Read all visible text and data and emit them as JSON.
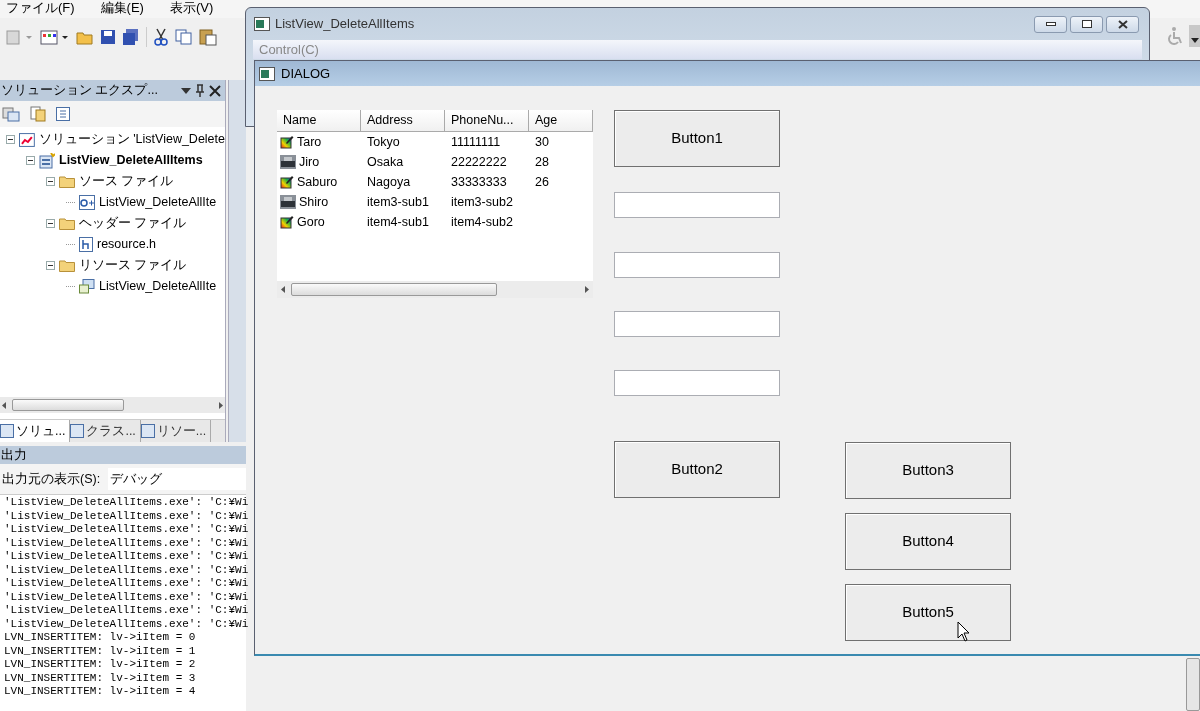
{
  "ide": {
    "menu": [
      "ファイル(F)",
      "編集(E)",
      "表示(V)"
    ],
    "solution_explorer": {
      "title": "ソリューション エクスプ...",
      "tree": [
        {
          "kind": "solution",
          "label": "ソリューション 'ListView_Delete",
          "expanded": true,
          "children": [
            {
              "kind": "project",
              "label": "ListView_DeleteAllItems",
              "expanded": true,
              "children": [
                {
                  "kind": "folder",
                  "label": "ソース ファイル",
                  "expanded": true,
                  "children": [
                    {
                      "kind": "cpp",
                      "label": "ListView_DeleteAllIte"
                    }
                  ]
                },
                {
                  "kind": "folder",
                  "label": "ヘッダー ファイル",
                  "expanded": true,
                  "children": [
                    {
                      "kind": "header",
                      "label": "resource.h"
                    }
                  ]
                },
                {
                  "kind": "folder",
                  "label": "リソース ファイル",
                  "expanded": true,
                  "children": [
                    {
                      "kind": "resource",
                      "label": "ListView_DeleteAllIte"
                    }
                  ]
                }
              ]
            }
          ]
        }
      ],
      "tabs": [
        {
          "label": "ソリュ...",
          "selected": true
        },
        {
          "label": "クラス...",
          "selected": false
        },
        {
          "label": "リソー...",
          "selected": false
        }
      ]
    },
    "output": {
      "title": "出力",
      "source_label": "出力元の表示(S):",
      "source_value": "デバッグ",
      "lines": [
        "'ListView_DeleteAllItems.exe': 'C:¥Wi",
        "'ListView_DeleteAllItems.exe': 'C:¥Wi",
        "'ListView_DeleteAllItems.exe': 'C:¥Wi",
        "'ListView_DeleteAllItems.exe': 'C:¥Wi",
        "'ListView_DeleteAllItems.exe': 'C:¥Wi",
        "'ListView_DeleteAllItems.exe': 'C:¥Wi",
        "'ListView_DeleteAllItems.exe': 'C:¥Wi",
        "'ListView_DeleteAllItems.exe': 'C:¥Wi",
        "'ListView_DeleteAllItems.exe': 'C:¥Wi",
        "'ListView_DeleteAllItems.exe': 'C:¥Wi",
        "LVN_INSERTITEM: lv->iItem = 0",
        "LVN_INSERTITEM: lv->iItem = 1",
        "LVN_INSERTITEM: lv->iItem = 2",
        "LVN_INSERTITEM: lv->iItem = 3",
        "LVN_INSERTITEM: lv->iItem = 4"
      ]
    }
  },
  "main_window": {
    "title": "ListView_DeleteAllItems",
    "menu": [
      "Control(C)"
    ]
  },
  "dialog": {
    "title": "DIALOG",
    "list_view": {
      "columns": [
        "Name",
        "Address",
        "PhoneNu...",
        "Age"
      ],
      "rows": [
        {
          "kind": "pencil",
          "cells": [
            "Taro",
            "Tokyo",
            "11111111",
            "30"
          ]
        },
        {
          "kind": "photo",
          "cells": [
            "Jiro",
            "Osaka",
            "22222222",
            "28"
          ]
        },
        {
          "kind": "pencil",
          "cells": [
            "Saburo",
            "Nagoya",
            "33333333",
            "26"
          ]
        },
        {
          "kind": "photo",
          "cells": [
            "Shiro",
            "item3-sub1",
            "item3-sub2"
          ]
        },
        {
          "kind": "pencil",
          "cells": [
            "Goro",
            "item4-sub1",
            "item4-sub2"
          ]
        }
      ]
    },
    "buttons": [
      "Button1",
      "Button2",
      "Button3",
      "Button4",
      "Button5"
    ]
  }
}
